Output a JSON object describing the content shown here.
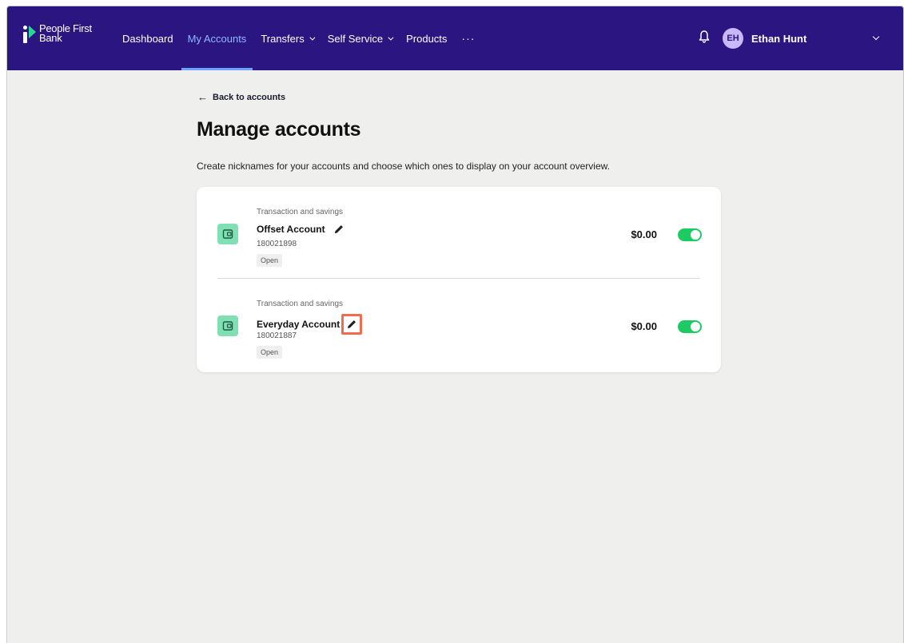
{
  "brand": {
    "name_line1": "People First",
    "name_line2": "Bank",
    "primary_color": "#2a1581",
    "accent_color": "#2fd39a"
  },
  "nav": {
    "items": [
      {
        "label": "Dashboard",
        "active": false,
        "dropdown": false
      },
      {
        "label": "My Accounts",
        "active": true,
        "dropdown": false
      },
      {
        "label": "Transfers",
        "active": false,
        "dropdown": true
      },
      {
        "label": "Self Service",
        "active": false,
        "dropdown": true
      },
      {
        "label": "Products",
        "active": false,
        "dropdown": false
      },
      {
        "label": "···",
        "active": false,
        "dropdown": false
      }
    ]
  },
  "user": {
    "initials": "EH",
    "name": "Ethan Hunt"
  },
  "page": {
    "back_label": "Back to accounts",
    "title": "Manage accounts",
    "description": "Create nicknames for your accounts and choose which ones to display on your account overview."
  },
  "accounts": [
    {
      "type": "Transaction and savings",
      "name": "Offset Account",
      "number": "180021898",
      "status": "Open",
      "balance": "$0.00",
      "displayed": true
    },
    {
      "type": "Transaction and savings",
      "name": "Everyday Account",
      "number": "180021887",
      "status": "Open",
      "balance": "$0.00",
      "displayed": true
    }
  ],
  "colors": {
    "toggle_on": "#1ecb62",
    "account_icon_bg": "#7fe0b4",
    "highlight": "#f26b4f"
  },
  "icons": {
    "notifications": "bell-icon",
    "account": "wallet-icon",
    "edit": "pencil-icon",
    "back": "arrow-left-icon"
  }
}
